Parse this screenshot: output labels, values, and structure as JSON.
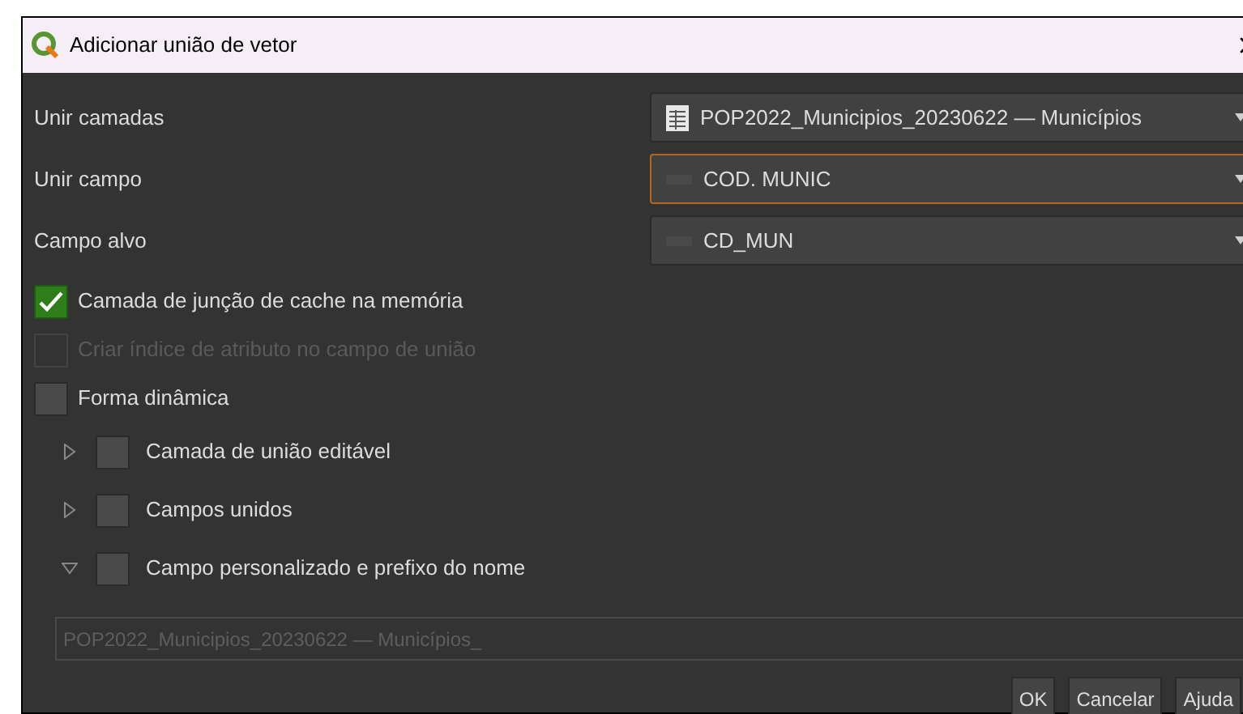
{
  "window": {
    "title": "Adicionar união de vetor"
  },
  "fields": [
    {
      "label": "Unir camadas",
      "value": "POP2022_Municipios_20230622 — Municípios",
      "kind": "layer",
      "focused": false
    },
    {
      "label": "Unir campo",
      "value": "COD. MUNIC",
      "kind": "text_field",
      "focused": true
    },
    {
      "label": "Campo alvo",
      "value": "CD_MUN",
      "kind": "text_field",
      "focused": false
    }
  ],
  "checkboxes": [
    {
      "label": "Camada de junção de cache na memória",
      "checked": true,
      "disabled": false
    },
    {
      "label": "Criar índice de atributo no campo de união",
      "checked": false,
      "disabled": true
    },
    {
      "label": "Forma dinâmica",
      "checked": false,
      "disabled": false
    }
  ],
  "groups": [
    {
      "label": "Camada de união editável",
      "checked": false,
      "expanded": false
    },
    {
      "label": "Campos unidos",
      "checked": false,
      "expanded": false
    },
    {
      "label": "Campo personalizado e prefixo do nome",
      "checked": false,
      "expanded": true
    }
  ],
  "prefix_field": {
    "value": "POP2022_Municipios_20230622 — Municípios_",
    "disabled": true
  },
  "buttons": [
    "OK",
    "Cancelar",
    "Ajuda"
  ]
}
